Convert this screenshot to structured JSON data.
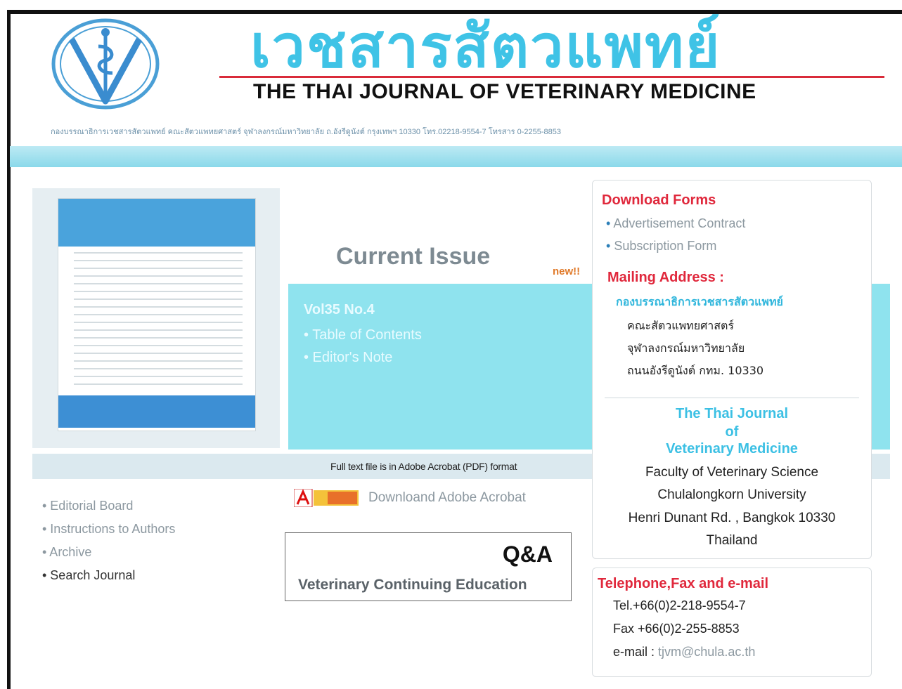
{
  "header": {
    "thai_title": "เวชสารสัตวแพทย์",
    "english_title": "THE THAI JOURNAL OF VETERINARY MEDICINE",
    "address_line": "กองบรรณาธิการเวชสารสัตวแพทย์ คณะสัตวแพทยศาสตร์ จุฬาลงกรณ์มหาวิทยาลัย ถ.อังรีดูนังต์ กรุงเทพฯ 10330 โทร.02218-9554-7 โทรสาร 0-2255-8853"
  },
  "current_issue": {
    "heading": "Current Issue",
    "new_badge": "new!!",
    "volume": "Vol35 No.4",
    "links": [
      "• Table of Contents",
      "• Editor's Note"
    ]
  },
  "fulltext_note": "Full text file is in Adobe Acrobat (PDF) format",
  "acrobat": {
    "icon_name": "adobe-reader-icon",
    "download_label": "Downloand Adobe Acrobat"
  },
  "left_nav": [
    "• Editorial Board",
    "• Instructions to Authors",
    "• Archive",
    "• Search Journal"
  ],
  "qa": {
    "title": "Q&A",
    "subtitle": "Veterinary  Continuing  Education"
  },
  "sidebar": {
    "download_forms_title": "Download Forms",
    "forms": [
      "Advertisement Contract",
      "Subscription Form"
    ],
    "mailing_title": "Mailing Address :",
    "thai_org": "กองบรรณาธิการเวชสารสัตวแพทย์",
    "thai_lines": [
      "คณะสัตวแพทยศาสตร์",
      "จุฬาลงกรณ์มหาวิทยาลัย",
      "ถนนอังรีดูนังต์ กทม. 10330"
    ],
    "journal_name_lines": [
      "The Thai Journal",
      "of",
      "Veterinary Medicine"
    ],
    "faculty_lines": [
      "Faculty of Veterinary Science",
      "Chulalongkorn University",
      "Henri Dunant Rd. , Bangkok 10330",
      "Thailand"
    ],
    "contact_title": "Telephone,Fax and e-mail",
    "tel": "Tel.+66(0)2-218-9554-7",
    "fax": "Fax +66(0)2-255-8853",
    "email_label": "e-mail : ",
    "email_value": "tjvm@chula.ac.th"
  },
  "colors": {
    "accent_cyan": "#3fc3e6",
    "panel_cyan": "#8fe3ee",
    "heading_red": "#e0283c"
  }
}
